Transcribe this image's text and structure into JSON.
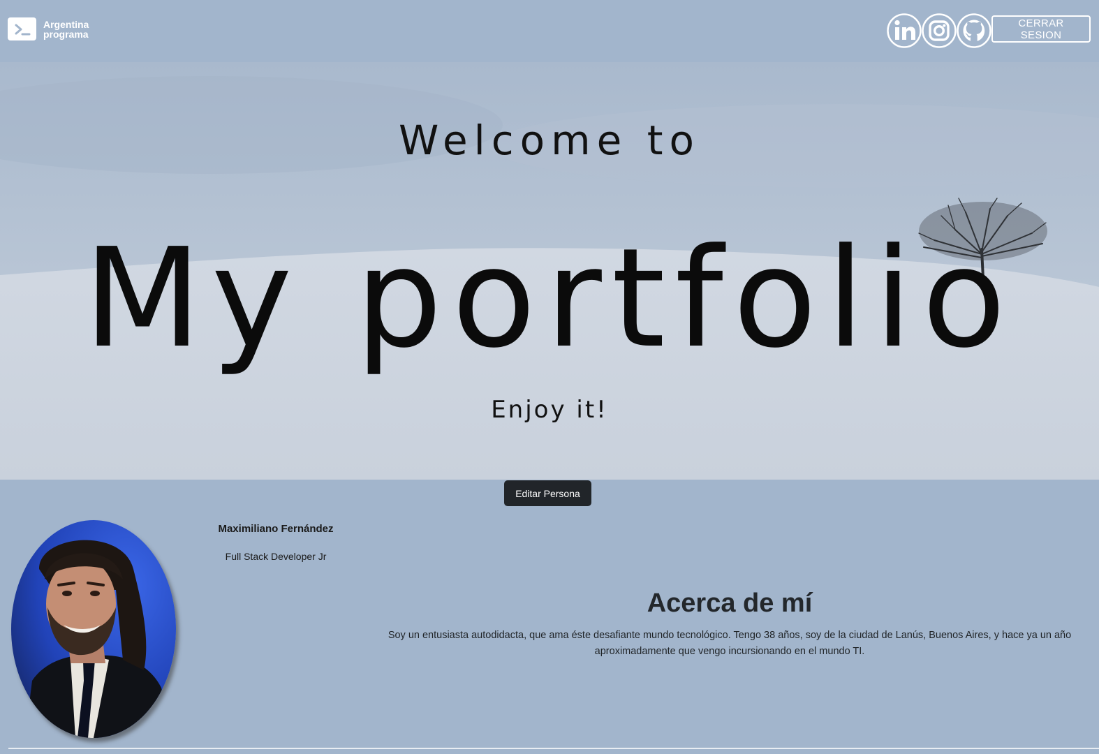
{
  "header": {
    "logo_line1": "Argentina",
    "logo_line2": "programa",
    "logo_icon": "terminal-prompt-icon",
    "social": [
      {
        "name": "linkedin",
        "icon": "linkedin-icon"
      },
      {
        "name": "instagram",
        "icon": "instagram-icon"
      },
      {
        "name": "github",
        "icon": "github-icon"
      }
    ],
    "logout_label": "CERRAR SESION"
  },
  "hero": {
    "welcome": "Welcome to",
    "title": "My portfolio",
    "subtitle": "Enjoy it!"
  },
  "persona": {
    "edit_label": "Editar Persona",
    "name": "Maximiliano Fernández",
    "role": "Full Stack Developer Jr",
    "about_title": "Acerca de mí",
    "about_text": "Soy un entusiasta autodidacta, que ama éste desafiante mundo tecnológico. Tengo 38 años, soy de la ciudad de Lanús, Buenos Aires, y hace ya un año aproximadamente que vengo incursionando en el mundo TI."
  },
  "colors": {
    "page_bg": "#a2b5cc",
    "button_dark": "#212529",
    "white": "#ffffff"
  }
}
